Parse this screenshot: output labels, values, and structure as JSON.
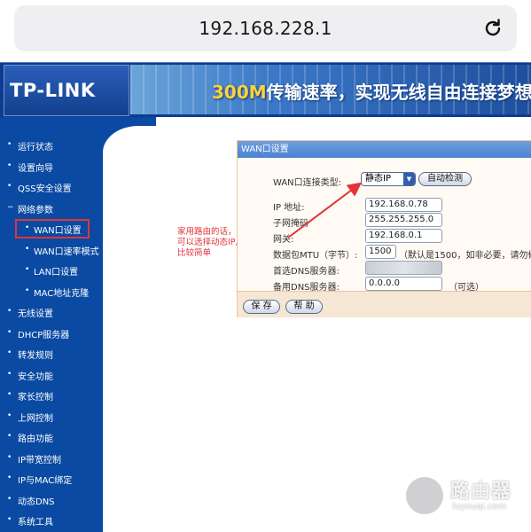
{
  "browser": {
    "url": "192.168.228.1",
    "reload_icon": "reload-icon"
  },
  "header": {
    "logo": "TP-LINK",
    "banner_highlight": "300M",
    "banner_text": "传输速率，实现无线自由连接梦想"
  },
  "sidebar": {
    "items": [
      {
        "label": "运行状态",
        "sub": false
      },
      {
        "label": "设置向导",
        "sub": false
      },
      {
        "label": "QSS安全设置",
        "sub": false
      },
      {
        "label": "网络参数",
        "sub": false,
        "expanded": true
      },
      {
        "label": "WAN口设置",
        "sub": true,
        "selected": true
      },
      {
        "label": "WAN口速率模式",
        "sub": true
      },
      {
        "label": "LAN口设置",
        "sub": true
      },
      {
        "label": "MAC地址克隆",
        "sub": true
      },
      {
        "label": "无线设置",
        "sub": false
      },
      {
        "label": "DHCP服务器",
        "sub": false
      },
      {
        "label": "转发规则",
        "sub": false
      },
      {
        "label": "安全功能",
        "sub": false
      },
      {
        "label": "家长控制",
        "sub": false
      },
      {
        "label": "上网控制",
        "sub": false
      },
      {
        "label": "路由功能",
        "sub": false
      },
      {
        "label": "IP带宽控制",
        "sub": false
      },
      {
        "label": "IP与MAC绑定",
        "sub": false
      },
      {
        "label": "动态DNS",
        "sub": false
      },
      {
        "label": "系统工具",
        "sub": false
      }
    ]
  },
  "wan_panel": {
    "title": "WAN口设置",
    "conn_type_label": "WAN口连接类型:",
    "conn_type_value": "静态IP",
    "auto_detect": "自动检测",
    "ip_label": "IP 地址:",
    "ip_value": "192.168.0.78",
    "mask_label": "子网掩码",
    "mask_value": "255.255.255.0",
    "gateway_label": "网关:",
    "gateway_value": "192.168.0.1",
    "mtu_label": "数据包MTU（字节）:",
    "mtu_value": "1500",
    "mtu_note": "（默认是1500，如非必要，请勿修",
    "dns1_label": "首选DNS服务器:",
    "dns2_label": "备用DNS服务器:",
    "dns2_value": "0.0.0.0",
    "dns2_note": "（可选）",
    "save": "保 存",
    "help": "帮 助"
  },
  "annotation": {
    "line1": "家用路由的话，",
    "line2": "可以选择动态IP,",
    "line3": "比较简单"
  },
  "watermark": {
    "title": "路由器",
    "sub": "luyouqi.com"
  },
  "colors": {
    "sidebar": "#0a4aa2",
    "header": "#0d3c8f",
    "annotation": "#e0343a",
    "panel_title": "#4b82d0"
  }
}
